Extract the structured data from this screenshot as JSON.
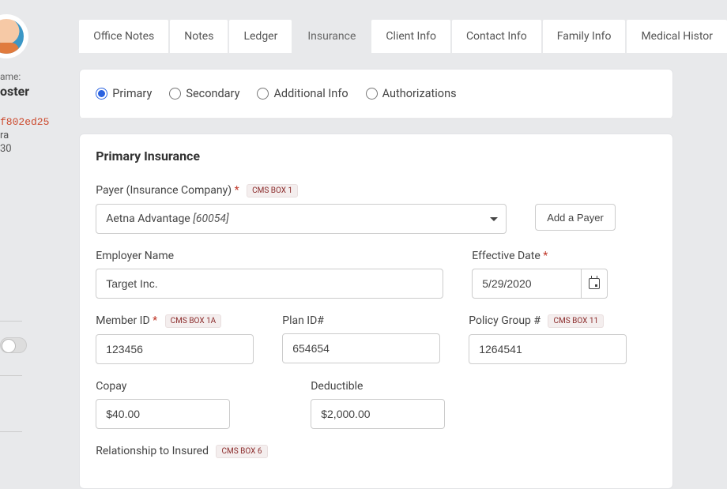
{
  "sidebar": {
    "name_label": "ame:",
    "name_value": "oster",
    "client_id": "f802ed25",
    "subline1": "ra",
    "subline2": "30"
  },
  "tabs": [
    {
      "id": "office-notes",
      "label": "Office Notes"
    },
    {
      "id": "notes",
      "label": "Notes"
    },
    {
      "id": "ledger",
      "label": "Ledger"
    },
    {
      "id": "insurance",
      "label": "Insurance"
    },
    {
      "id": "client-info",
      "label": "Client Info"
    },
    {
      "id": "contact-info",
      "label": "Contact Info"
    },
    {
      "id": "family-info",
      "label": "Family Info"
    },
    {
      "id": "medical-history",
      "label": "Medical Histor"
    }
  ],
  "insurance_types": {
    "primary": "Primary",
    "secondary": "Secondary",
    "additional": "Additional Info",
    "authorizations": "Authorizations",
    "selected": "primary"
  },
  "section": {
    "title": "Primary Insurance",
    "payer": {
      "label": "Payer (Insurance Company)",
      "required": "*",
      "cms": "CMS BOX 1",
      "value_main": "Aetna Advantage",
      "value_id": "[60054]",
      "add_button": "Add a Payer"
    },
    "employer": {
      "label": "Employer Name",
      "value": "Target Inc."
    },
    "effective_date": {
      "label": "Effective Date",
      "required": "*",
      "value": "5/29/2020"
    },
    "member_id": {
      "label": "Member ID",
      "required": "*",
      "cms": "CMS BOX 1A",
      "value": "123456"
    },
    "plan_id": {
      "label": "Plan ID#",
      "value": "654654"
    },
    "policy_group": {
      "label": "Policy Group #",
      "cms": "CMS BOX 11",
      "value": "1264541"
    },
    "copay": {
      "label": "Copay",
      "value": "$40.00"
    },
    "deductible": {
      "label": "Deductible",
      "value": "$2,000.00"
    },
    "relationship": {
      "label": "Relationship to Insured",
      "cms": "CMS BOX 6"
    }
  }
}
